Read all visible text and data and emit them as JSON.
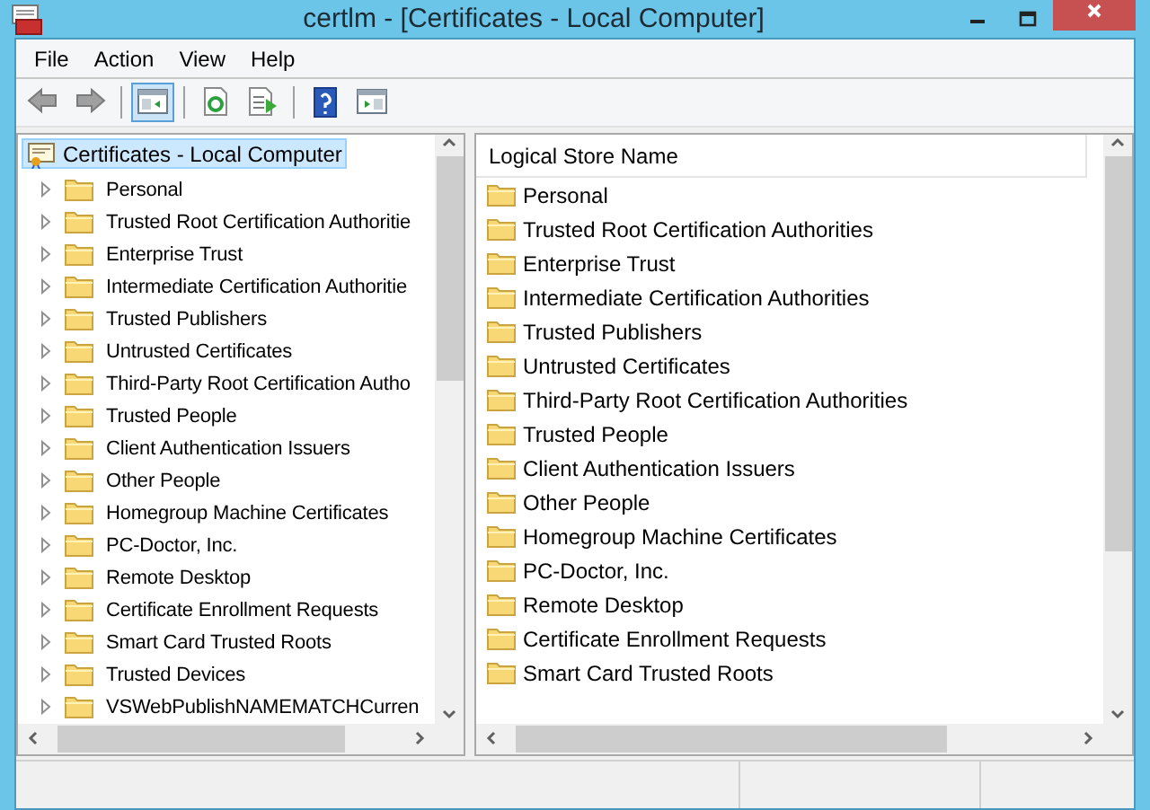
{
  "window": {
    "title": "certlm - [Certificates - Local Computer]"
  },
  "menu": [
    "File",
    "Action",
    "View",
    "Help"
  ],
  "toolbar": [
    {
      "kind": "back",
      "selected": false
    },
    {
      "kind": "forward",
      "selected": false
    },
    {
      "kind": "tree",
      "selected": true
    },
    {
      "kind": "refresh",
      "selected": false
    },
    {
      "kind": "export",
      "selected": false
    },
    {
      "kind": "help",
      "selected": false
    },
    {
      "kind": "pane",
      "selected": false
    }
  ],
  "tree": {
    "label": "Certificates - Local Computer",
    "selected": true,
    "children": [
      {
        "label": "Personal",
        "expanded": false
      },
      {
        "label": "Trusted Root Certification Authoritie",
        "expanded": false
      },
      {
        "label": "Enterprise Trust",
        "expanded": false
      },
      {
        "label": "Intermediate Certification Authoritie",
        "expanded": false
      },
      {
        "label": "Trusted Publishers",
        "expanded": false
      },
      {
        "label": "Untrusted Certificates",
        "expanded": false
      },
      {
        "label": "Third-Party Root Certification Autho",
        "expanded": false
      },
      {
        "label": "Trusted People",
        "expanded": false
      },
      {
        "label": "Client Authentication Issuers",
        "expanded": false
      },
      {
        "label": "Other People",
        "expanded": false
      },
      {
        "label": "Homegroup Machine Certificates",
        "expanded": false
      },
      {
        "label": "PC-Doctor, Inc.",
        "expanded": false
      },
      {
        "label": "Remote Desktop",
        "expanded": false
      },
      {
        "label": "Certificate Enrollment Requests",
        "expanded": false
      },
      {
        "label": "Smart Card Trusted Roots",
        "expanded": false
      },
      {
        "label": "Trusted Devices",
        "expanded": false
      },
      {
        "label": "VSWebPublishNAMEMATCHCurren",
        "expanded": false
      }
    ]
  },
  "list": {
    "column": "Logical Store Name",
    "rows": [
      "Personal",
      "Trusted Root Certification Authorities",
      "Enterprise Trust",
      "Intermediate Certification Authorities",
      "Trusted Publishers",
      "Untrusted Certificates",
      "Third-Party Root Certification Authorities",
      "Trusted People",
      "Client Authentication Issuers",
      "Other People",
      "Homegroup Machine Certificates",
      "PC-Doctor, Inc.",
      "Remote Desktop",
      "Certificate Enrollment Requests",
      "Smart Card Trusted Roots"
    ]
  }
}
